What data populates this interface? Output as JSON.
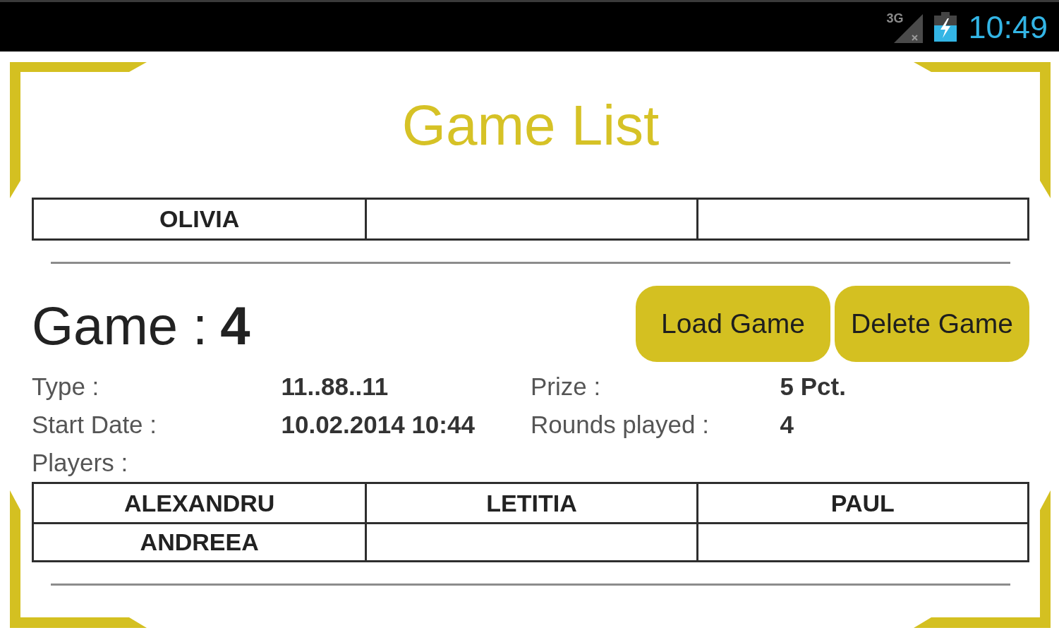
{
  "status_bar": {
    "network_type": "3G",
    "time": "10:49"
  },
  "title": "Game List",
  "upper_table": {
    "cells": [
      "OLIVIA"
    ]
  },
  "game": {
    "label": "Game :",
    "number": "4"
  },
  "buttons": [
    {
      "label": "Load Game"
    },
    {
      "label": "Delete Game"
    }
  ],
  "details": [
    {
      "label": "Type :",
      "value": "11..88..11"
    },
    {
      "label": "Prize :",
      "value": "5 Pct."
    },
    {
      "label": "Start Date :",
      "value": "10.02.2014 10:44"
    },
    {
      "label": "Rounds played :",
      "value": "4"
    }
  ],
  "players_label": "Players :",
  "players_table": {
    "cells": [
      "ALEXANDRU",
      "LETITIA",
      "PAUL",
      "ANDREEA"
    ]
  }
}
